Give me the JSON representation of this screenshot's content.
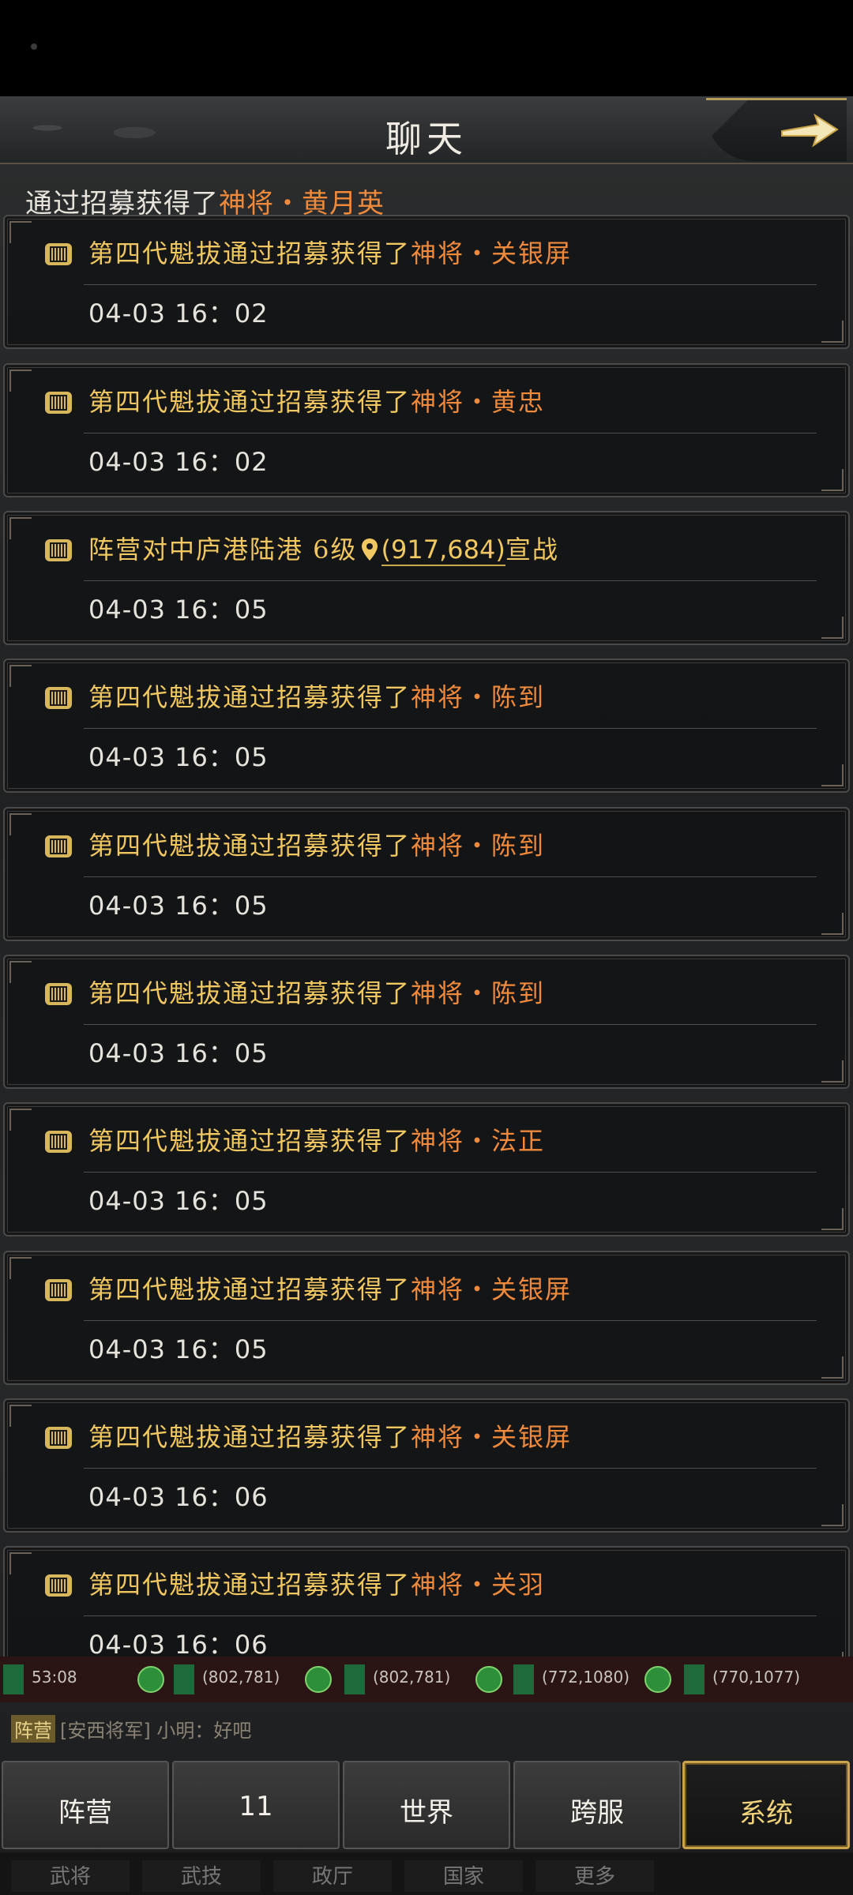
{
  "header": {
    "title": "聊天"
  },
  "partial": {
    "prefix": "通过招募获得了",
    "highlight": "神将・黄月英"
  },
  "messages": [
    {
      "prefix": "第四代魁拔通过招募获得了",
      "highlight": "神将・关银屏",
      "time": "04-03  16：02"
    },
    {
      "prefix": "第四代魁拔通过招募获得了",
      "highlight": "神将・黄忠",
      "time": "04-03  16：02"
    },
    {
      "prefix": "阵营对中庐港陆港 6级",
      "coord": "(917,684)",
      "suffix": "宣战",
      "time": "04-03  16：05"
    },
    {
      "prefix": "第四代魁拔通过招募获得了",
      "highlight": "神将・陈到",
      "time": "04-03  16：05"
    },
    {
      "prefix": "第四代魁拔通过招募获得了",
      "highlight": "神将・陈到",
      "time": "04-03  16：05"
    },
    {
      "prefix": "第四代魁拔通过招募获得了",
      "highlight": "神将・陈到",
      "time": "04-03  16：05"
    },
    {
      "prefix": "第四代魁拔通过招募获得了",
      "highlight": "神将・法正",
      "time": "04-03  16：05"
    },
    {
      "prefix": "第四代魁拔通过招募获得了",
      "highlight": "神将・关银屏",
      "time": "04-03  16：05"
    },
    {
      "prefix": "第四代魁拔通过招募获得了",
      "highlight": "神将・关银屏",
      "time": "04-03  16：06"
    },
    {
      "prefix": "第四代魁拔通过招募获得了",
      "highlight": "神将・关羽",
      "time": "04-03  16：06"
    }
  ],
  "ticker": [
    "53:08",
    "(802,781)",
    "(802,781)",
    "(772,1080)",
    "(770,1077)"
  ],
  "faction_line": {
    "badge": "阵营",
    "text": "[安西将军] 小明：好吧"
  },
  "tabs": [
    "阵营",
    "11",
    "世界",
    "跨服",
    "系统"
  ],
  "active_tab": "系统",
  "bottom_nav": [
    "武将",
    "武技",
    "政厅",
    "国家",
    "更多"
  ],
  "colors": {
    "highlight": "#ef8a3c",
    "message_text": "#f0c760",
    "active_border": "#c9a44a"
  }
}
